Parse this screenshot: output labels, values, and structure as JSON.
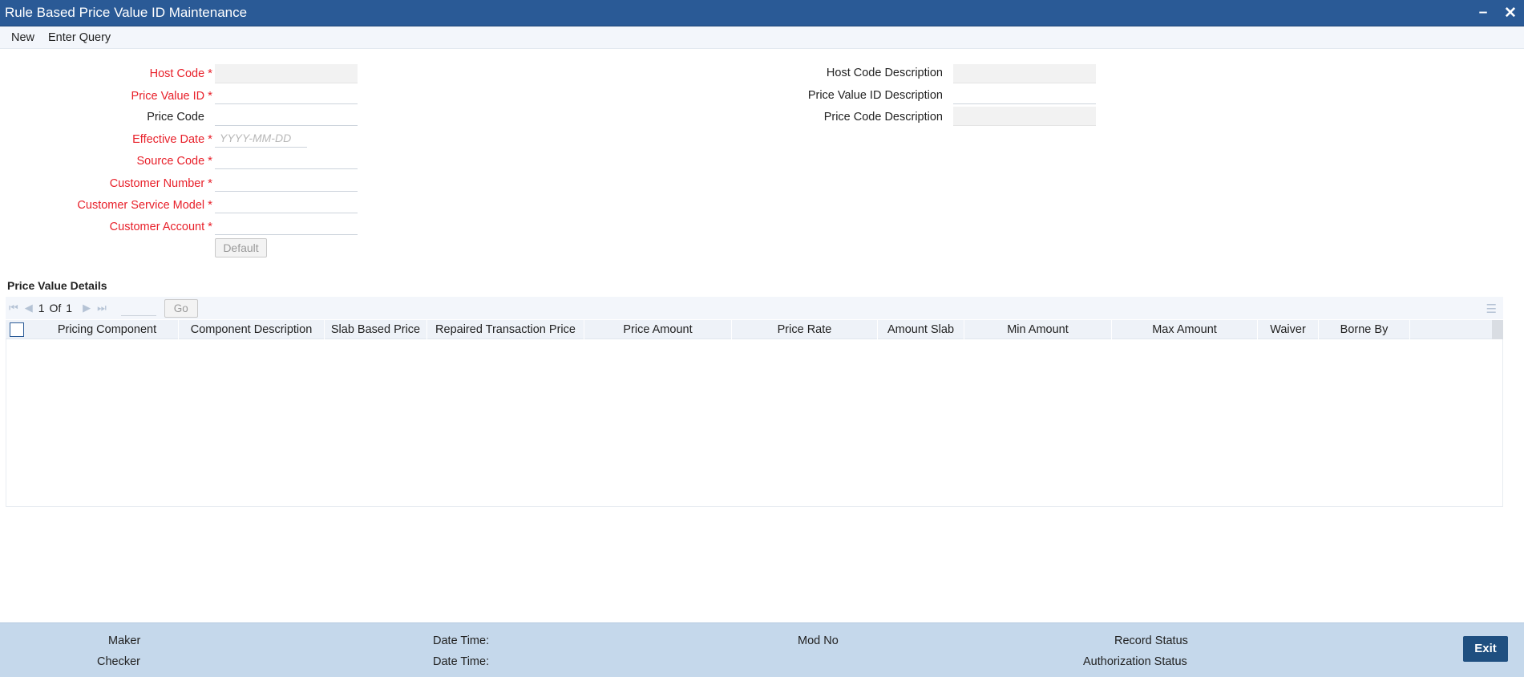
{
  "window": {
    "title": "Rule Based Price Value ID Maintenance",
    "minimize_icon": "minimize-icon",
    "close_icon": "close-icon"
  },
  "menu": {
    "new_label": "New",
    "enter_query_label": "Enter Query"
  },
  "form": {
    "host_code": {
      "label": "Host Code",
      "value": ""
    },
    "price_value_id": {
      "label": "Price Value ID",
      "value": ""
    },
    "price_code": {
      "label": "Price Code",
      "value": ""
    },
    "effective_date": {
      "label": "Effective Date",
      "value": "",
      "placeholder": "YYYY-MM-DD"
    },
    "source_code": {
      "label": "Source Code",
      "value": ""
    },
    "customer_number": {
      "label": "Customer Number",
      "value": ""
    },
    "customer_service_model": {
      "label": "Customer Service Model",
      "value": ""
    },
    "customer_account": {
      "label": "Customer Account",
      "value": ""
    },
    "default_button": "Default",
    "required_marker": "*",
    "host_code_description": {
      "label": "Host Code Description",
      "value": ""
    },
    "price_value_id_description": {
      "label": "Price Value ID Description",
      "value": ""
    },
    "price_code_description": {
      "label": "Price Code Description",
      "value": ""
    }
  },
  "price_value_details": {
    "title": "Price Value Details",
    "pager": {
      "current": "1",
      "of_label": "Of",
      "total": "1",
      "go_label": "Go"
    },
    "columns": [
      "Pricing Component",
      "Component Description",
      "Slab Based Price",
      "Repaired Transaction Price",
      "Price Amount",
      "Price Rate",
      "Amount Slab",
      "Min Amount",
      "Max Amount",
      "Waiver",
      "Borne By"
    ],
    "rows": []
  },
  "footer": {
    "maker_label": "Maker",
    "checker_label": "Checker",
    "date_time_label_1": "Date Time:",
    "date_time_label_2": "Date Time:",
    "mod_no_label": "Mod No",
    "record_status_label": "Record Status",
    "authorization_status_label": "Authorization Status",
    "exit_label": "Exit"
  },
  "colors": {
    "titlebar": "#2a5a96",
    "required": "#e8202a",
    "footer": "#c5d8eb",
    "exit_button": "#1f4f80"
  }
}
